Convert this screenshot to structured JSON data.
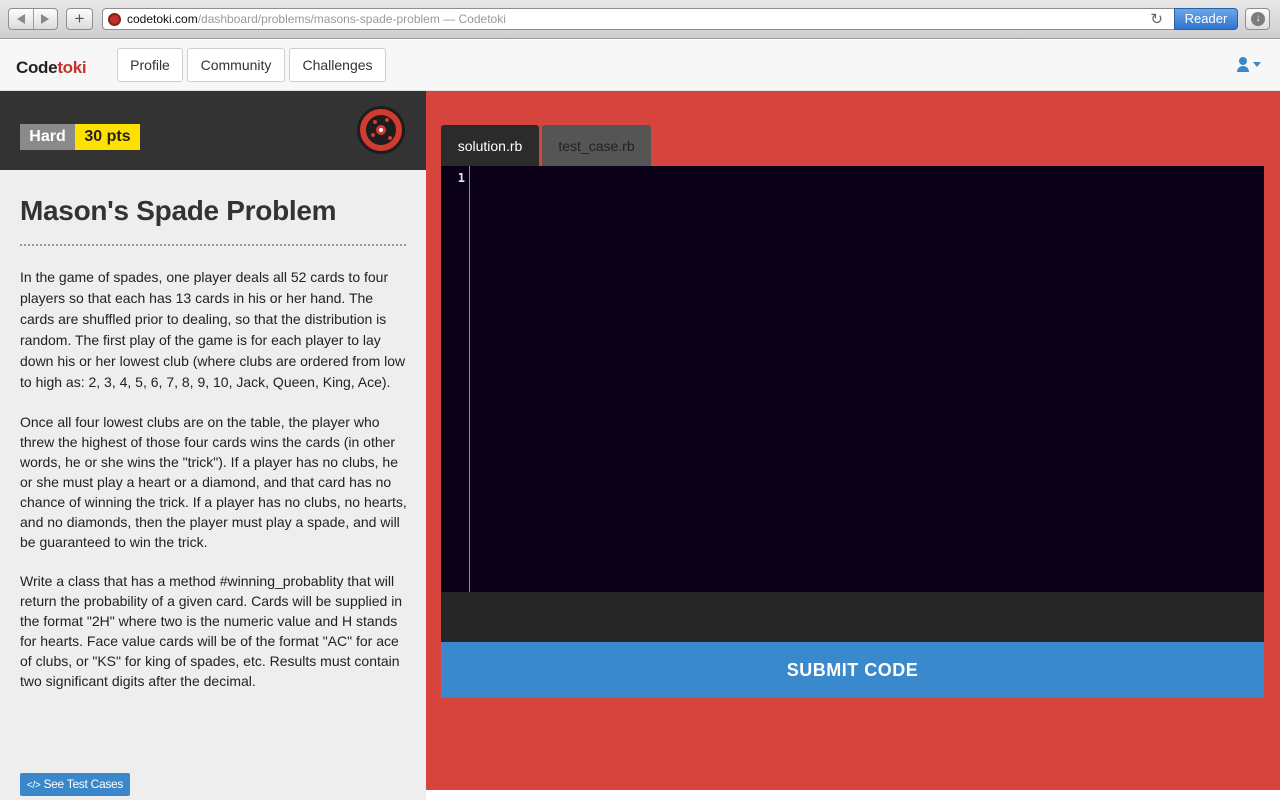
{
  "browser": {
    "url_host": "codetoki.com",
    "url_path": "/dashboard/problems/masons-spade-problem",
    "page_title": " — Codetoki",
    "reader_label": "Reader",
    "new_tab_label": "+"
  },
  "header": {
    "logo_part1": "Code",
    "logo_part2": "toki",
    "nav": [
      "Profile",
      "Community",
      "Challenges"
    ]
  },
  "problem": {
    "difficulty": "Hard",
    "points": "30 pts",
    "title": "Mason's Spade Problem",
    "paragraphs": [
      "In the game of spades, one player deals all 52 cards to four players so that each has 13 cards in his or her hand. The cards are shuffled prior to dealing, so that the distribution is random. The first play of the game is for each player to lay down his or her lowest club (where clubs are ordered from low to high as: 2, 3, 4, 5, 6, 7, 8, 9, 10, Jack, Queen, King, Ace).",
      "Once all four lowest clubs are on the table, the player who threw the highest of those four cards wins the cards (in other words, he or she wins the \"trick\"). If a player has no clubs, he or she must play a heart or a diamond, and that card has no chance of winning the trick. If a player has no clubs, no hearts, and no diamonds, then the player must play a spade, and will be guaranteed to win the trick.",
      "Write a class that has a method #winning_probablity that will return the probability of a given card. Cards will be supplied in the format \"2H\" where two is the numeric value and H stands for hearts. Face value cards will be of the format \"AC\" for ace of clubs, or \"KS\" for king of spades, etc. Results must contain two significant digits after the decimal."
    ],
    "test_cases_icon": "</>",
    "test_cases_label": "See Test Cases"
  },
  "editor": {
    "tabs": [
      "solution.rb",
      "test_case.rb"
    ],
    "active_tab": 0,
    "line_numbers": [
      "1"
    ],
    "submit_label": "SUBMIT CODE"
  },
  "colors": {
    "editor_panel_bg": "#d7443e",
    "editor_bg": "#0a0018",
    "submit_bg": "#3b89cd",
    "points_badge": "#ffe100",
    "logo_accent": "#c9302c"
  }
}
